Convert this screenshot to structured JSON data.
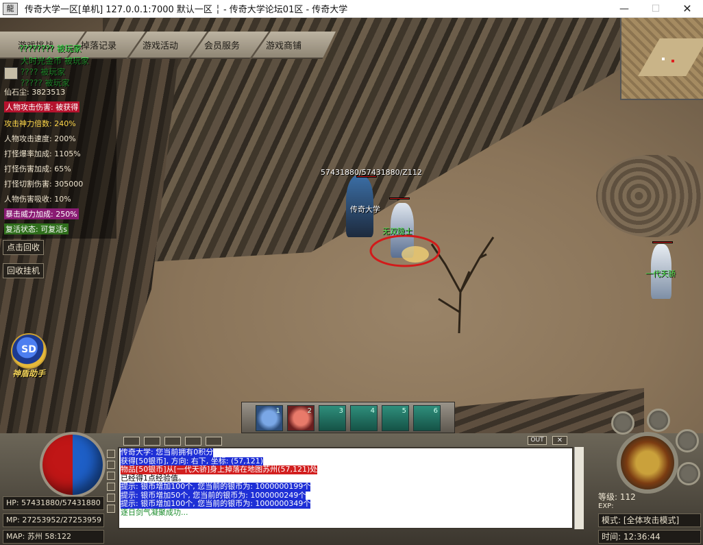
{
  "window": {
    "icon_text": "龍",
    "title": "传奇大学一区[单机] 127.0.0.1:7000  默认一区 ╎ - 传奇大学论坛01区 - 传奇大学",
    "minimize": "—",
    "maximize": "☐",
    "close": "✕"
  },
  "top_menu": {
    "tabs": [
      "游戏挑战",
      "掉落记录",
      "游戏活动",
      "会员服务",
      "游戏商铺"
    ]
  },
  "promo_lines": [
    "???????? 被玩家",
    "大时光金币 被玩家",
    "???? 被玩家",
    "????? 被玩家"
  ],
  "stats_panel": {
    "rows": [
      {
        "label": "仙石尘: 3823513"
      },
      {
        "label": "人物攻击伤害: 被获得"
      },
      {
        "label": "攻击神力倍数: 240%"
      },
      {
        "label": "人物攻击速度: 200%"
      },
      {
        "label": "打怪爆率加成: 1105%"
      },
      {
        "label": "打怪伤害加成: 65%"
      },
      {
        "label": "打怪切割伤害: 305000"
      },
      {
        "label": "人物伤害吸收: 10%"
      },
      {
        "label": "暴击威力加成: 250%"
      },
      {
        "label": "复活状态: 可复活s"
      }
    ]
  },
  "side_buttons": {
    "recycle": "点击回收",
    "auto_recycle": "回收挂机"
  },
  "helper": {
    "badge": "SD",
    "label": "神盾助手"
  },
  "characters": {
    "player_hp_text": "57431880/57431880/Z112",
    "player_name": "传奇大学",
    "enemy1_name": "无双隐士",
    "enemy2_name": "一代天骄"
  },
  "skills": [
    {
      "key": "1"
    },
    {
      "key": "2"
    },
    {
      "key": "3"
    },
    {
      "key": "4"
    },
    {
      "key": "5"
    },
    {
      "key": "6"
    }
  ],
  "chat": {
    "out_label": "OUT",
    "close_label": "✕",
    "lines": [
      {
        "text": "传奇大学: 您当前拥有0积分",
        "style": "blue"
      },
      {
        "text": "获得[50银币], 方向: 右下, 坐标: (57,121)",
        "style": "blue"
      },
      {
        "text": "物品[50银币]从[一代天骄]身上掉落在地图苏州(57,121)处",
        "style": "red"
      },
      {
        "text": "已经得1点经验值。",
        "style": "plain"
      },
      {
        "text": "提示: 银币增加100个, 您当前的银币为: 1000000199个",
        "style": "blue"
      },
      {
        "text": "提示: 银币增加50个, 您当前的银币为: 1000000249个",
        "style": "blue"
      },
      {
        "text": "提示: 银币增加100个, 您当前的银币为: 1000000349个",
        "style": "blue"
      },
      {
        "text": "逐日剑气凝聚成功...",
        "style": "green"
      }
    ]
  },
  "status_left": {
    "hp": "HP: 57431880/57431880",
    "mp": "MP: 27253952/27253959",
    "map": "MAP: 苏州 58:122"
  },
  "status_right": {
    "level": "等级: 112",
    "exp": "EXP:",
    "mode": "模式: [全体攻击模式]",
    "time": "时间:  12:36:44"
  }
}
